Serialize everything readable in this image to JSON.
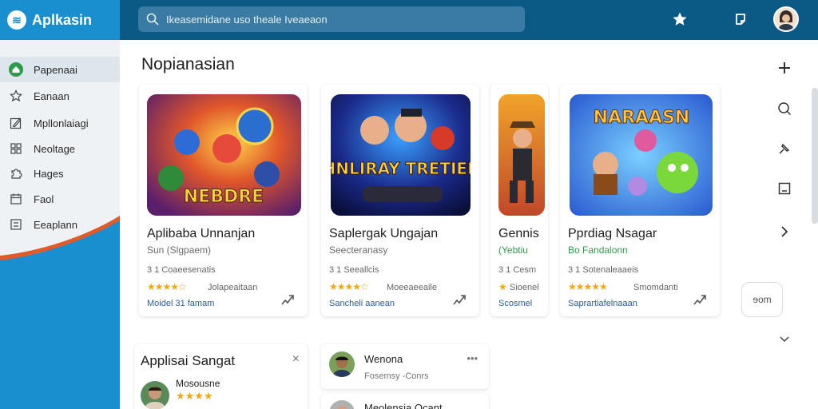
{
  "app": {
    "name": "Aplkasin",
    "logo_glyph": "≋"
  },
  "search": {
    "placeholder": "Ikeasemidane uso theale Iveaeaon"
  },
  "sidebar": {
    "items": [
      {
        "label": "Papenaai",
        "icon": "home-icon",
        "active": true
      },
      {
        "label": "Eanaan",
        "icon": "star-outline-icon"
      },
      {
        "label": "Mpllonlaiagi",
        "icon": "edit-icon"
      },
      {
        "label": "Neoltage",
        "icon": "grid-icon"
      },
      {
        "label": "Hages",
        "icon": "puzzle-icon"
      },
      {
        "label": "Faol",
        "icon": "calendar-icon"
      },
      {
        "label": "Eeaplann",
        "icon": "list-icon"
      }
    ]
  },
  "main": {
    "section_title": "Nopianasian",
    "cards": [
      {
        "title": "Aplibaba Unnanjan",
        "subtitle": "Sun (Slgpaem)",
        "subtitle_green": false,
        "meta": "3 1 Coaeesenatis",
        "stars": "★★★★☆",
        "rating_text": "Jolapeaitaan",
        "link": "Moidel 31 famam",
        "art_text": "NEBDRE"
      },
      {
        "title": "Saplergak Ungajan",
        "subtitle": "Seecteranasy",
        "subtitle_green": false,
        "meta": "3 1 Seeallcis",
        "stars": "★★★★☆",
        "rating_text": "Moeeaeeaile",
        "link": "Sancheli aanean",
        "art_text": "SHNLIRAY TRETIERS"
      },
      {
        "title": "Gennis",
        "subtitle": "(Yebtiu",
        "subtitle_green": true,
        "meta": "3 1 Cesm",
        "stars": "★",
        "rating_text": "Sioenel",
        "link": "Scosmel",
        "art_text": ""
      },
      {
        "title": "Pprdiag Nsagar",
        "subtitle": "Bo Fandalonn",
        "subtitle_green": true,
        "meta": "3 1 Sotenaleaaeis",
        "stars": "★★★★★",
        "rating_text": "Smomdanti",
        "link": "Saprartiafelnaaan",
        "art_text": "NARAASN"
      }
    ],
    "more_button": "ɘom"
  },
  "panel_left": {
    "title": "Applisai Sangat",
    "close": "×",
    "user_name": "Mosousne",
    "stars": "★★★★"
  },
  "panel_mid": {
    "top_name": "Wenona",
    "top_sub": "Fosemsy -Conrs",
    "more": "•••",
    "second_name": "Meolensia Ocant"
  }
}
